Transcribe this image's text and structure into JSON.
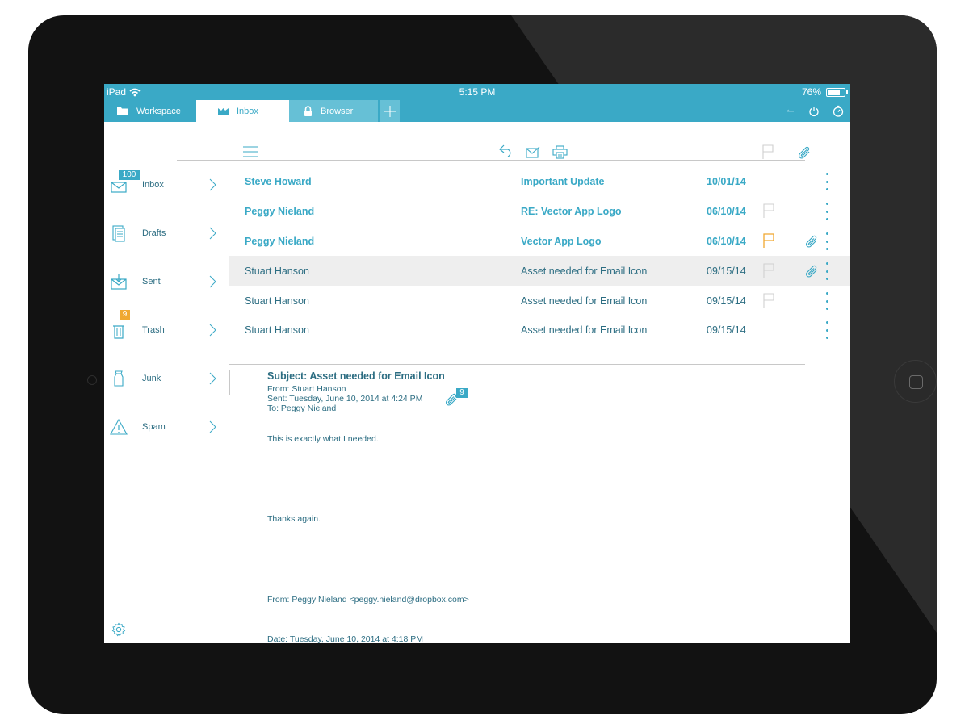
{
  "status_bar": {
    "device": "iPad",
    "time": "5:15 PM",
    "battery": "76%",
    "battery_level": 0.76
  },
  "tabs": [
    {
      "label": "Workspace",
      "icon": "folder-icon"
    },
    {
      "label": "Inbox",
      "icon": "inbox-tray-icon"
    },
    {
      "label": "Browser",
      "icon": "lock-icon"
    },
    {
      "label": "+",
      "icon": "add-tab-icon"
    }
  ],
  "tab_actions": [
    "back-icon",
    "power-icon",
    "stopwatch-icon"
  ],
  "toolbar": [
    "menu-icon",
    "reply-icon",
    "compose-icon",
    "print-icon",
    "flag-icon",
    "paperclip-icon"
  ],
  "sidebar": {
    "items": [
      {
        "label": "Inbox",
        "badge": "100",
        "icon": "inbox-icon"
      },
      {
        "label": "Drafts",
        "badge": "",
        "icon": "drafts-icon"
      },
      {
        "label": "Sent",
        "badge": "",
        "icon": "sent-icon"
      },
      {
        "label": "Trash",
        "badge": "9",
        "icon": "trash-icon"
      },
      {
        "label": "Junk",
        "badge": "",
        "icon": "junk-icon"
      },
      {
        "label": "Spam",
        "badge": "",
        "icon": "warning-icon"
      }
    ],
    "settings_icon": "gear-icon"
  },
  "messages": [
    {
      "from": "Steve Howard",
      "subject": "Important Update",
      "date": "10/01/14",
      "unread": true,
      "flag": "none",
      "attachment": false,
      "selected": false
    },
    {
      "from": "Peggy Nieland",
      "subject": "RE: Vector App Logo",
      "date": "06/10/14",
      "unread": true,
      "flag": "outline",
      "attachment": false,
      "selected": false
    },
    {
      "from": "Peggy Nieland",
      "subject": "Vector App Logo",
      "date": "06/10/14",
      "unread": true,
      "flag": "flagged",
      "attachment": true,
      "selected": false
    },
    {
      "from": "Stuart Hanson",
      "subject": "Asset needed for Email Icon",
      "date": "09/15/14",
      "unread": false,
      "flag": "outline",
      "attachment": true,
      "selected": true
    },
    {
      "from": "Stuart Hanson",
      "subject": "Asset needed for Email Icon",
      "date": "09/15/14",
      "unread": false,
      "flag": "outline",
      "attachment": false,
      "selected": false
    },
    {
      "from": "Stuart Hanson",
      "subject": "Asset needed for Email Icon",
      "date": "09/15/14",
      "unread": false,
      "flag": "none",
      "attachment": false,
      "selected": false
    }
  ],
  "detail": {
    "subject": "Subject: Asset needed for Email Icon",
    "from": "From: Stuart Hanson",
    "sent": "Sent: Tuesday, June 10, 2014 at 4:24 PM",
    "to": "To: Peggy Nieland",
    "attachment_count": "9",
    "body_1": "This is exactly what I needed.",
    "body_2": "Thanks again.",
    "quoted_from": "From: Peggy Nieland <peggy.nieland@dropbox.com>",
    "quoted_date": "Date: Tuesday, June 10, 2014 at 4:18 PM"
  },
  "colors": {
    "accent": "#3aa9c6",
    "text_dark": "#2c6d82",
    "flag": "#f0a830",
    "badge_orange": "#f0a830",
    "selected_row": "#eeeeee",
    "bezel": "#121212"
  }
}
